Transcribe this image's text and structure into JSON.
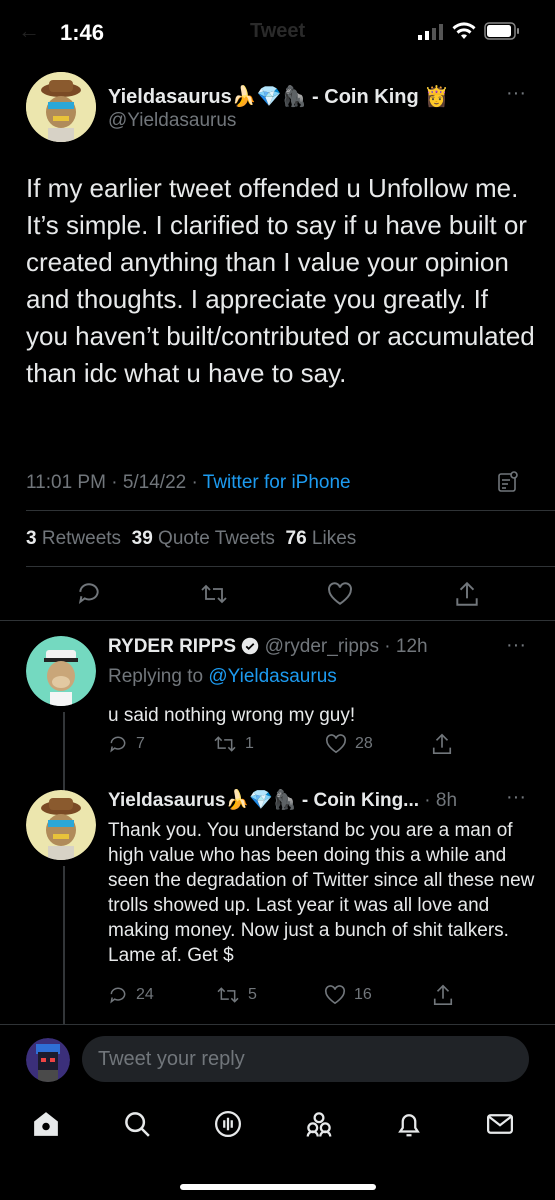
{
  "status_bar": {
    "time": "1:46"
  },
  "header": {
    "title": "Tweet"
  },
  "main_tweet": {
    "name": "Yieldasaurus",
    "name_suffix": "- Coin King",
    "emojis": [
      "🍌",
      "💎",
      "🦍",
      "👸"
    ],
    "handle": "@Yieldasaurus",
    "text": "If my earlier tweet offended u Unfollow me. It’s simple. I clarified to say if u have built or created anything than I value your opinion and thoughts. I appreciate you greatly. If you haven’t built/contributed or accumulated than idc what u have to say.",
    "time": "11:01 PM",
    "date": "5/14/22",
    "source": "Twitter for iPhone",
    "retweets_count": "3",
    "retweets_label": "Retweets",
    "quotes_count": "39",
    "quotes_label": "Quote Tweets",
    "likes_count": "76",
    "likes_label": "Likes"
  },
  "replies": [
    {
      "name": "RYDER RIPPS",
      "handle": "@ryder_ripps",
      "age": "12h",
      "replying_label": "Replying to",
      "replying_to": "@Yieldasaurus",
      "text": "u said nothing wrong my guy!",
      "replies": "7",
      "retweets": "1",
      "likes": "28"
    },
    {
      "name": "Yieldasaurus",
      "name_suffix": "- Coin King...",
      "emojis": [
        "🍌",
        "💎",
        "🦍"
      ],
      "age": "8h",
      "text": "Thank you. You understand bc you are a man of high value who has been doing this a while and seen the degradation of Twitter since all these new trolls showed up. Last year it was all love and making money. Now just a bunch of shit talkers. Lame af. Get $",
      "replies": "24",
      "retweets": "5",
      "likes": "16"
    }
  ],
  "composer": {
    "placeholder": "Tweet your reply"
  },
  "colors": {
    "accent": "#1d9bf0",
    "background": "#000000",
    "muted": "#71767b",
    "verified": "#e7e9ea"
  },
  "icons": [
    "back-arrow-icon",
    "signal-icon",
    "wifi-icon",
    "battery-icon",
    "more-icon",
    "analytics-icon",
    "reply-icon",
    "retweet-icon",
    "like-icon",
    "share-icon",
    "verified-icon",
    "home-icon",
    "search-icon",
    "spaces-icon",
    "communities-icon",
    "notifications-icon",
    "messages-icon"
  ]
}
